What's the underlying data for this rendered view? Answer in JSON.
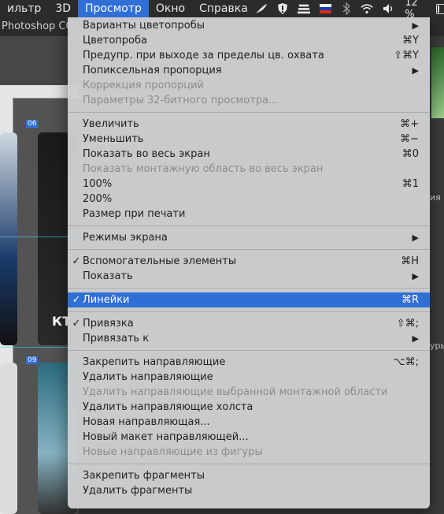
{
  "menubar": {
    "items": [
      "ильтр",
      "3D",
      "Просмотр",
      "Окно",
      "Справка"
    ],
    "active_index": 2,
    "status": {
      "battery_text": "12 %",
      "battery_level": 0.12,
      "icons": [
        "feather-icon",
        "shield-icon",
        "stack-icon",
        "flag-ru-icon",
        "bluetooth-icon",
        "wifi-icon",
        "volume-icon",
        "battery-icon"
      ]
    }
  },
  "app": {
    "title": "Photoshop CC",
    "artboard_labels": [
      "06",
      "09"
    ],
    "canvas_text": "КТ",
    "side_labels": [
      "ия",
      "уры"
    ]
  },
  "menu": {
    "groups": [
      [
        {
          "label": "Варианты цветопробы",
          "shortcut": "",
          "submenu": true,
          "disabled": false,
          "checked": false
        },
        {
          "label": "Цветопроба",
          "shortcut": "⌘Y",
          "submenu": false,
          "disabled": false,
          "checked": false
        },
        {
          "label": "Предупр. при выходе за пределы цв. охвата",
          "shortcut": "⇧⌘Y",
          "submenu": false,
          "disabled": false,
          "checked": false
        },
        {
          "label": "Попиксельная пропорция",
          "shortcut": "",
          "submenu": true,
          "disabled": false,
          "checked": false
        },
        {
          "label": "Коррекция пропорций",
          "shortcut": "",
          "submenu": false,
          "disabled": true,
          "checked": false
        },
        {
          "label": "Параметры 32-битного просмотра...",
          "shortcut": "",
          "submenu": false,
          "disabled": true,
          "checked": false
        }
      ],
      [
        {
          "label": "Увеличить",
          "shortcut": "⌘+",
          "submenu": false,
          "disabled": false,
          "checked": false
        },
        {
          "label": "Уменьшить",
          "shortcut": "⌘−",
          "submenu": false,
          "disabled": false,
          "checked": false
        },
        {
          "label": "Показать во весь экран",
          "shortcut": "⌘0",
          "submenu": false,
          "disabled": false,
          "checked": false
        },
        {
          "label": "Показать монтажную область во весь экран",
          "shortcut": "",
          "submenu": false,
          "disabled": true,
          "checked": false
        },
        {
          "label": "100%",
          "shortcut": "⌘1",
          "submenu": false,
          "disabled": false,
          "checked": false
        },
        {
          "label": "200%",
          "shortcut": "",
          "submenu": false,
          "disabled": false,
          "checked": false
        },
        {
          "label": "Размер при печати",
          "shortcut": "",
          "submenu": false,
          "disabled": false,
          "checked": false
        }
      ],
      [
        {
          "label": "Режимы экрана",
          "shortcut": "",
          "submenu": true,
          "disabled": false,
          "checked": false
        }
      ],
      [
        {
          "label": "Вспомогательные элементы",
          "shortcut": "⌘H",
          "submenu": false,
          "disabled": false,
          "checked": true
        },
        {
          "label": "Показать",
          "shortcut": "",
          "submenu": true,
          "disabled": false,
          "checked": false
        }
      ],
      [
        {
          "label": "Линейки",
          "shortcut": "⌘R",
          "submenu": false,
          "disabled": false,
          "checked": true,
          "highlight": true
        }
      ],
      [
        {
          "label": "Привязка",
          "shortcut": "⇧⌘;",
          "submenu": false,
          "disabled": false,
          "checked": true
        },
        {
          "label": "Привязать к",
          "shortcut": "",
          "submenu": true,
          "disabled": false,
          "checked": false
        }
      ],
      [
        {
          "label": "Закрепить направляющие",
          "shortcut": "⌥⌘;",
          "submenu": false,
          "disabled": false,
          "checked": false
        },
        {
          "label": "Удалить направляющие",
          "shortcut": "",
          "submenu": false,
          "disabled": false,
          "checked": false
        },
        {
          "label": "Удалить направляющие выбранной монтажной области",
          "shortcut": "",
          "submenu": false,
          "disabled": true,
          "checked": false
        },
        {
          "label": "Удалить направляющие холста",
          "shortcut": "",
          "submenu": false,
          "disabled": false,
          "checked": false
        },
        {
          "label": "Новая направляющая...",
          "shortcut": "",
          "submenu": false,
          "disabled": false,
          "checked": false
        },
        {
          "label": "Новый макет направляющей...",
          "shortcut": "",
          "submenu": false,
          "disabled": false,
          "checked": false
        },
        {
          "label": "Новые направляющие из фигуры",
          "shortcut": "",
          "submenu": false,
          "disabled": true,
          "checked": false
        }
      ],
      [
        {
          "label": "Закрепить фрагменты",
          "shortcut": "",
          "submenu": false,
          "disabled": false,
          "checked": false
        },
        {
          "label": "Удалить фрагменты",
          "shortcut": "",
          "submenu": false,
          "disabled": false,
          "checked": false
        }
      ]
    ]
  },
  "colors": {
    "highlight": "#2f6fd6",
    "menu_bg": "#ccced0",
    "disabled_text": "#8c8c8c"
  }
}
